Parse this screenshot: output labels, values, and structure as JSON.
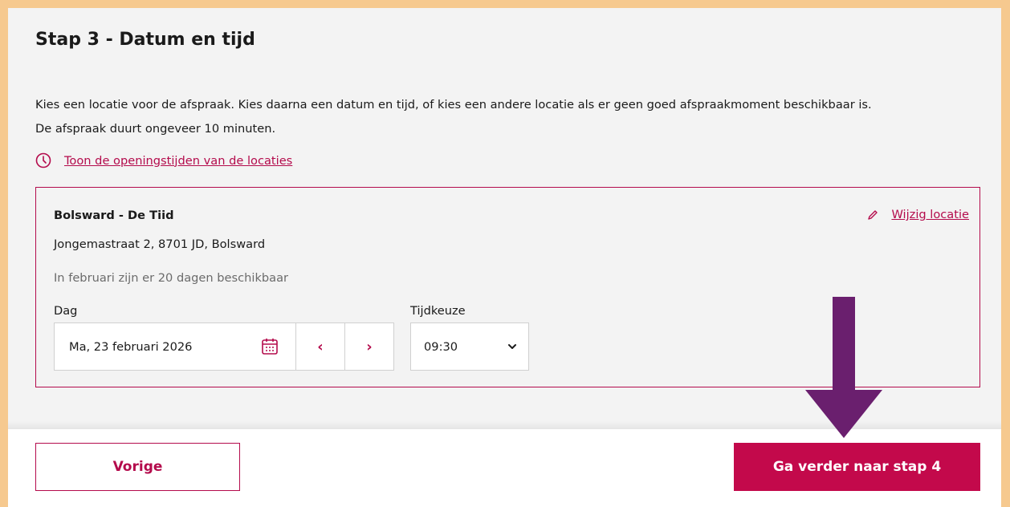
{
  "step_title": "Stap 3 - Datum en tijd",
  "intro": {
    "line1": "Kies een locatie voor de afspraak. Kies daarna een datum en tijd, of kies een andere locatie als er geen goed afspraakmoment beschikbaar is.",
    "line2": "De afspraak duurt ongeveer 10 minuten."
  },
  "hours_link": {
    "icon": "clock-icon",
    "label": "Toon de openingstijden van de locaties"
  },
  "location": {
    "name": "Bolsward - De Tiid",
    "address": "Jongemastraat 2, 8701 JD, Bolsward",
    "availability": "In februari zijn er 20 dagen beschikbaar",
    "edit_label": "Wijzig locatie",
    "edit_icon": "pencil-icon"
  },
  "day_field": {
    "label": "Dag",
    "value": "Ma, 23 februari 2026",
    "calendar_icon": "calendar-icon",
    "prev_symbol": "‹",
    "next_symbol": "›"
  },
  "time_field": {
    "label": "Tijdkeuze",
    "value": "09:30"
  },
  "footer": {
    "prev_label": "Vorige",
    "next_label": "Ga verder naar stap 4"
  },
  "colors": {
    "accent": "#b40b4c",
    "primary_button": "#c3094b",
    "frame": "#f6c98f",
    "annotation_arrow": "#6a1f6e"
  }
}
